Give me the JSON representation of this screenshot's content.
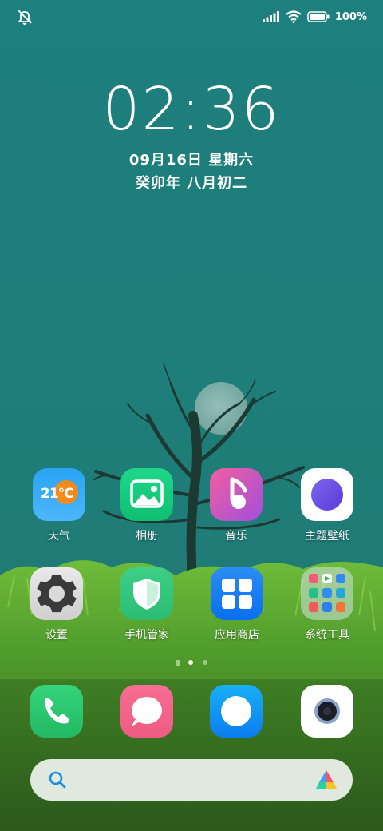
{
  "status_bar": {
    "left_icon": "bell-off-icon",
    "right_icons": [
      "signal-icon",
      "wifi-icon",
      "battery-icon"
    ],
    "battery_text": "100%"
  },
  "lockscreen_widget": {
    "time": "02:36",
    "date": "09月16日 星期六",
    "lunar_date": "癸卯年 八月初二"
  },
  "home_apps": [
    {
      "label": "天气",
      "icon": "weather-icon",
      "badge_text": "21°C"
    },
    {
      "label": "相册",
      "icon": "gallery-icon"
    },
    {
      "label": "音乐",
      "icon": "music-icon"
    },
    {
      "label": "主题壁纸",
      "icon": "themes-icon"
    },
    {
      "label": "设置",
      "icon": "settings-gear-icon"
    },
    {
      "label": "手机管家",
      "icon": "security-shield-icon"
    },
    {
      "label": "应用商店",
      "icon": "app-store-icon"
    },
    {
      "label": "系统工具",
      "icon": "folder-icon"
    }
  ],
  "page_indicator": {
    "pages": 2,
    "current": 1,
    "has_feed_page": true
  },
  "dock": [
    {
      "icon": "phone-icon"
    },
    {
      "icon": "messages-icon"
    },
    {
      "icon": "browser-icon"
    },
    {
      "icon": "camera-icon"
    }
  ],
  "search_bar": {
    "left_icon": "search-icon",
    "right_icon": "assistant-icon"
  },
  "colors": {
    "wallpaper_sky": "#1e7f7e",
    "grass": "#4e9a2a",
    "accent_blue": "#1a8ce0"
  }
}
